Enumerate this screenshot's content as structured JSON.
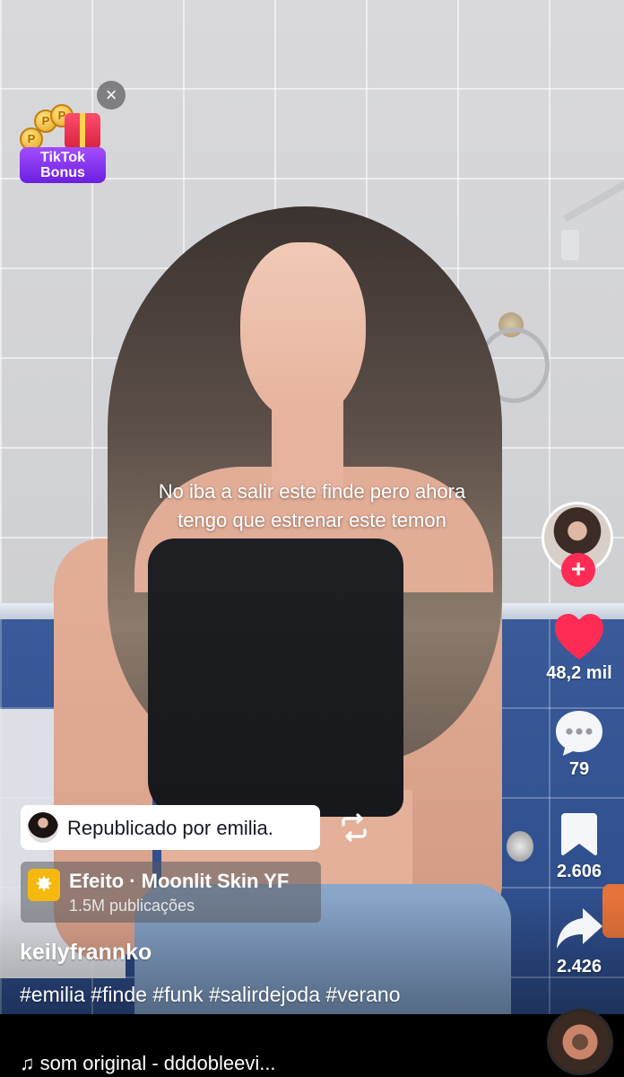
{
  "bonus": {
    "label_line1": "TikTok",
    "label_line2": "Bonus",
    "coin_glyph": "P",
    "close_glyph": "×"
  },
  "caption": {
    "line1": "No iba a salir este finde pero ahora",
    "line2": "tengo que estrenar este temon"
  },
  "rail": {
    "follow_glyph": "+",
    "likes": "48,2 mil",
    "comments": "79",
    "saves": "2.606",
    "shares": "2.426",
    "like_color": "#fe2c55"
  },
  "repost": {
    "text": "Republicado por emilia."
  },
  "effect": {
    "name": "Efeito · Moonlit Skin YF",
    "subtitle": "1.5M publicações"
  },
  "author": {
    "username": "keilyfrannko"
  },
  "description": {
    "hashtags": "#emilia #finde #funk #salirdejoda #verano"
  },
  "music": {
    "note_glyph": "♫",
    "text": "som original - dddobleevi..."
  }
}
